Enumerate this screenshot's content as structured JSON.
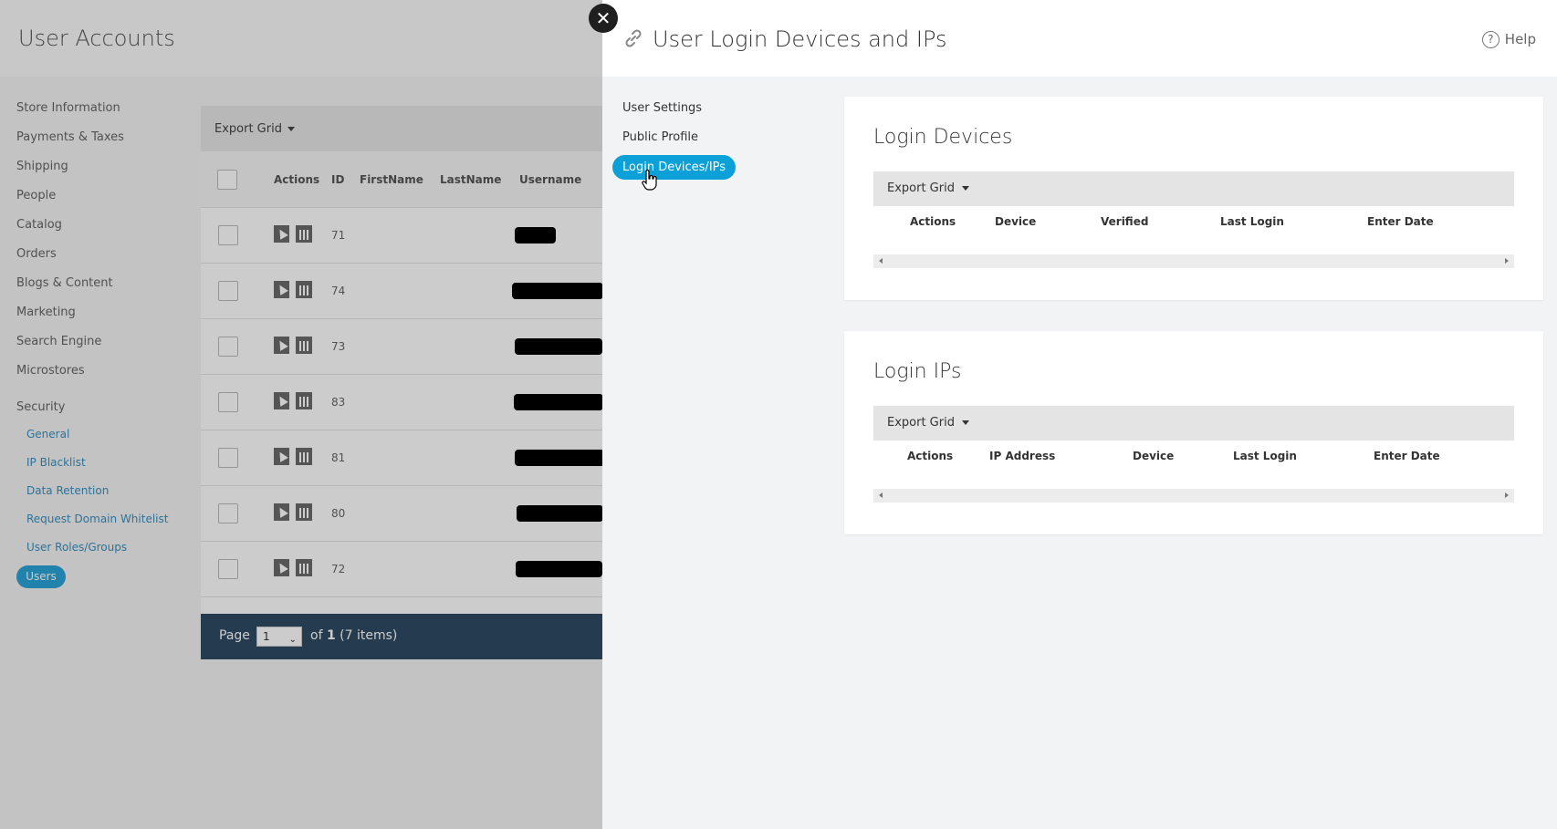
{
  "background": {
    "page_title": "User Accounts",
    "nav": [
      "Store Information",
      "Payments & Taxes",
      "Shipping",
      "People",
      "Catalog",
      "Orders",
      "Blogs & Content",
      "Marketing",
      "Search Engine",
      "Microstores",
      "Security"
    ],
    "security_sub": [
      "General",
      "IP Blacklist",
      "Data Retention",
      "Request Domain Whitelist",
      "User Roles/Groups"
    ],
    "active_item": "Users",
    "grid": {
      "export_label": "Export Grid",
      "columns": [
        "Actions",
        "ID",
        "FirstName",
        "LastName",
        "Username"
      ],
      "rows": [
        {
          "id": "71"
        },
        {
          "id": "74"
        },
        {
          "id": "73"
        },
        {
          "id": "83"
        },
        {
          "id": "81"
        },
        {
          "id": "80"
        },
        {
          "id": "72"
        }
      ],
      "pager": {
        "page_label": "Page",
        "page_value": "1",
        "of_prefix": "of ",
        "total_pages": "1",
        "items_text": " (7 items)"
      }
    }
  },
  "modal": {
    "title": "User Login Devices and IPs",
    "help_label": "Help",
    "help_icon_glyph": "?",
    "close_glyph": "✕",
    "nav": {
      "user_settings": "User Settings",
      "public_profile": "Public Profile",
      "login_devices_ips": "Login Devices/IPs"
    },
    "devices_card": {
      "title": "Login Devices",
      "export_label": "Export Grid",
      "columns": [
        "Actions",
        "Device",
        "Verified",
        "Last Login",
        "Enter Date"
      ]
    },
    "ips_card": {
      "title": "Login IPs",
      "export_label": "Export Grid",
      "columns": [
        "Actions",
        "IP Address",
        "Device",
        "Last Login",
        "Enter Date"
      ]
    }
  },
  "colors": {
    "accent": "#0ba0d8",
    "overlay": "rgba(0,0,0,0.2)",
    "footer": "#2f4a63"
  }
}
